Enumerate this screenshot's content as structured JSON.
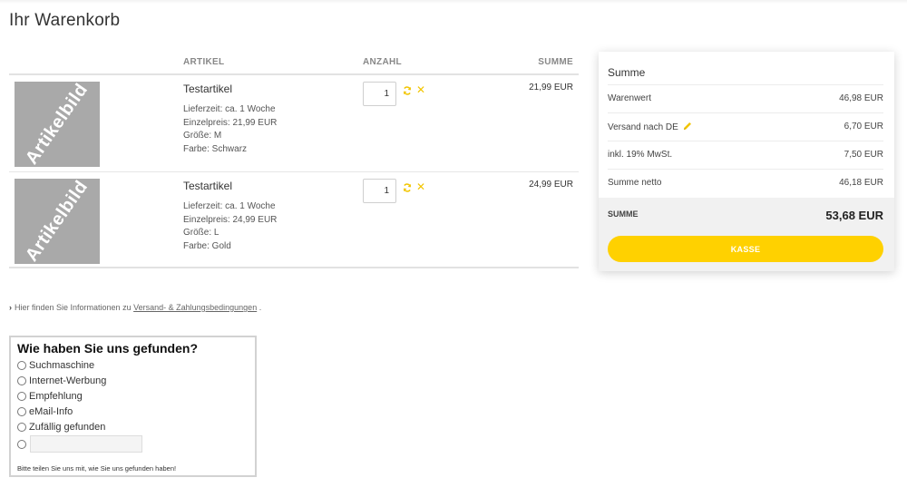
{
  "page": {
    "title": "Ihr Warenkorb"
  },
  "cart": {
    "headers": {
      "artikel": "ARTIKEL",
      "anzahl": "ANZAHL",
      "summe": "SUMME"
    },
    "items": [
      {
        "image_text": "Artikelbild",
        "name": "Testartikel",
        "lieferzeit": "Lieferzeit: ca. 1 Woche",
        "einzelpreis": "Einzelpreis: 21,99 EUR",
        "groesse": "Größe: M",
        "farbe": "Farbe: Schwarz",
        "quantity": "1",
        "sum": "21,99 EUR"
      },
      {
        "image_text": "Artikelbild",
        "name": "Testartikel",
        "lieferzeit": "Lieferzeit: ca. 1 Woche",
        "einzelpreis": "Einzelpreis: 24,99 EUR",
        "groesse": "Größe: L",
        "farbe": "Farbe: Gold",
        "quantity": "1",
        "sum": "24,99 EUR"
      }
    ],
    "icons": {
      "refresh": "refresh-icon",
      "remove": "close-icon",
      "remove_glyph": "✕"
    }
  },
  "info": {
    "chevron": "›",
    "prefix": "Hier finden Sie Informationen zu",
    "link": "Versand- & Zahlungsbedingungen",
    "suffix": "."
  },
  "survey": {
    "title": "Wie haben Sie uns gefunden?",
    "options": [
      "Suchmaschine",
      "Internet-Werbung",
      "Empfehlung",
      "eMail-Info",
      "Zufällig gefunden"
    ],
    "other_value": "",
    "note": "Bitte teilen Sie uns mit, wie Sie uns gefunden haben!"
  },
  "summary": {
    "title": "Summe",
    "rows": [
      {
        "label": "Warenwert",
        "value": "46,98 EUR"
      },
      {
        "label": "Versand nach DE",
        "value": "6,70 EUR"
      },
      {
        "label": "inkl. 19% MwSt.",
        "value": "7,50 EUR"
      },
      {
        "label": "Summe netto",
        "value": "46,18 EUR"
      }
    ],
    "total_label": "SUMME",
    "total_value": "53,68 EUR",
    "checkout_label": "KASSE"
  },
  "colors": {
    "accent": "#ffd100",
    "icon_yellow": "#f2c500",
    "placeholder_gray": "#a9a9a9"
  }
}
